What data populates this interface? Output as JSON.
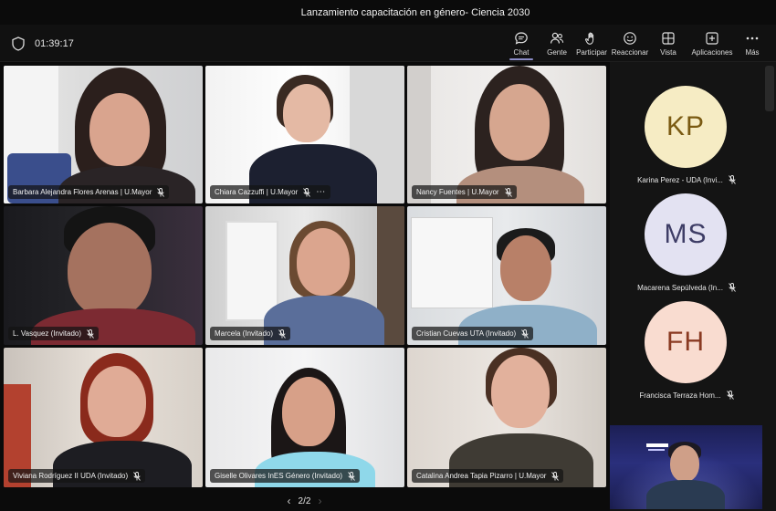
{
  "window": {
    "title": "Lanzamiento capacitación en género- Ciencia 2030"
  },
  "toolbar": {
    "timer": "01:39:17",
    "items": [
      {
        "label": "Chat",
        "icon": "chat-icon"
      },
      {
        "label": "Gente",
        "icon": "people-icon"
      },
      {
        "label": "Participar",
        "icon": "raise-hand-icon"
      },
      {
        "label": "Reaccionar",
        "icon": "smiley-icon"
      },
      {
        "label": "Vista",
        "icon": "grid-icon"
      },
      {
        "label": "Aplicaciones",
        "icon": "plus-icon"
      },
      {
        "label": "Más",
        "icon": "more-icon"
      }
    ]
  },
  "participants": [
    {
      "name": "Barbara Alejandra Flores Arenas | U.Mayor",
      "muted": true
    },
    {
      "name": "Chiara Cazzuffi | U.Mayor",
      "muted": true
    },
    {
      "name": "Nancy Fuentes | U.Mayor",
      "muted": true
    },
    {
      "name": "L. Vasquez (Invitado)",
      "muted": true
    },
    {
      "name": "Marcela (Invitado)",
      "muted": true
    },
    {
      "name": "Cristian Cuevas UTA (Invitado)",
      "muted": true
    },
    {
      "name": "Viviana Rodríguez II UDA (Invitado)",
      "muted": true
    },
    {
      "name": "Giselle Olivares InES Género (Invitado)",
      "muted": true
    },
    {
      "name": "Catalina Andrea Tapia Pizarro | U.Mayor",
      "muted": true
    }
  ],
  "sidebar": [
    {
      "initials": "KP",
      "name": "Karina Perez - UDA (Invi...",
      "color": "#f6ecc4"
    },
    {
      "initials": "MS",
      "name": "Macarena Sepúlveda (In...",
      "color": "#e3e2f2"
    },
    {
      "initials": "FH",
      "name": "Francisca Terraza Hom...",
      "color": "#f9dcd0"
    }
  ],
  "pager": {
    "label": "2/2"
  },
  "colors": {
    "accent": "#8b8cc7",
    "background": "#0b0b0b",
    "toolbar": "#111111"
  }
}
